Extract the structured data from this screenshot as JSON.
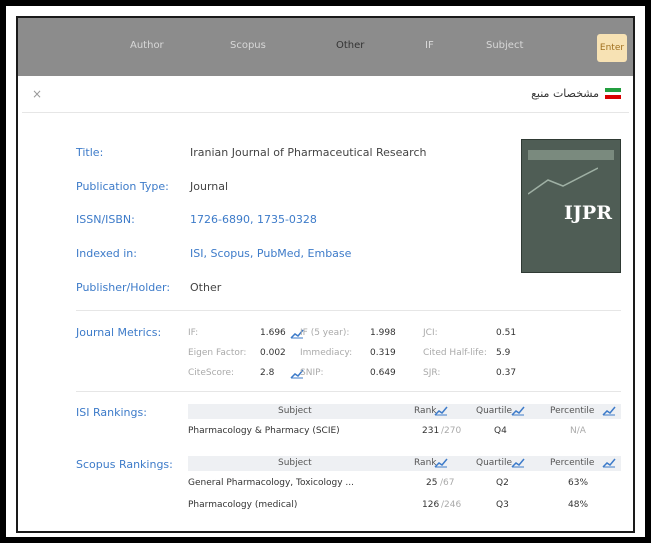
{
  "toolbar": {
    "items": [
      "Author",
      "Scopus",
      "Other",
      "IF",
      "Subject"
    ],
    "search_label": "Enter"
  },
  "modal": {
    "title": "مشخصات منبع",
    "close": "×"
  },
  "fields": {
    "title_label": "Title:",
    "title_value": "Iranian Journal of Pharmaceutical Research",
    "pubtype_label": "Publication Type:",
    "pubtype_value": "Journal",
    "issn_label": "ISSN/ISBN:",
    "issn_value": "1726-6890, 1735-0328",
    "indexed_label": "Indexed in:",
    "indexed_value": "ISI, Scopus, PubMed, Embase",
    "publisher_label": "Publisher/Holder:",
    "publisher_value": "Other"
  },
  "cover": {
    "text": "IJPR",
    "colors": {
      "bg": "#4f5d55",
      "text": "#ffffff"
    }
  },
  "metrics": {
    "label": "Journal Metrics:",
    "rows": [
      [
        {
          "k": "IF:",
          "v": "1.696",
          "chart": true
        },
        {
          "k": "IF (5 year):",
          "v": "1.998"
        },
        {
          "k": "JCI:",
          "v": "0.51"
        }
      ],
      [
        {
          "k": "Eigen Factor:",
          "v": "0.002"
        },
        {
          "k": "Immediacy:",
          "v": "0.319"
        },
        {
          "k": "Cited Half-life:",
          "v": "5.9"
        }
      ],
      [
        {
          "k": "CiteScore:",
          "v": "2.8",
          "chart": true
        },
        {
          "k": "SNIP:",
          "v": "0.649"
        },
        {
          "k": "SJR:",
          "v": "0.37"
        }
      ]
    ]
  },
  "isi": {
    "label": "ISI Rankings:",
    "headers": [
      "Subject",
      "Rank",
      "Quartile",
      "Percentile"
    ],
    "rows": [
      {
        "subject": "Pharmacology & Pharmacy (SCIE)",
        "rank": "231",
        "rank_suffix": "/270",
        "quartile": "Q4",
        "percentile": "N/A"
      }
    ]
  },
  "scopus": {
    "label": "Scopus Rankings:",
    "headers": [
      "Subject",
      "Rank",
      "Quartile",
      "Percentile"
    ],
    "rows": [
      {
        "subject": "General Pharmacology, Toxicology ...",
        "rank": "25",
        "rank_suffix": "/67",
        "quartile": "Q2",
        "percentile": "63%"
      },
      {
        "subject": "Pharmacology (medical)",
        "rank": "126",
        "rank_suffix": "/246",
        "quartile": "Q3",
        "percentile": "48%"
      }
    ]
  },
  "colors": {
    "accent": "#3d7bc9",
    "toolbar": "#8c8c8c"
  }
}
